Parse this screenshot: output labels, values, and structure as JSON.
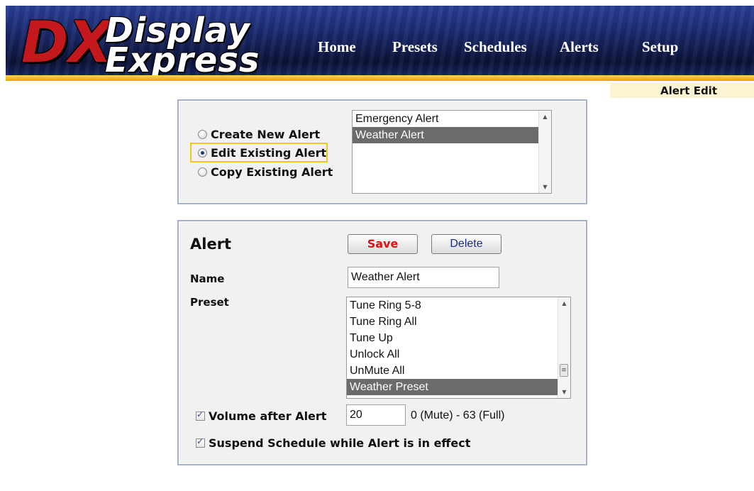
{
  "brand": {
    "logo_mark": "DX",
    "logo_line1": "Display",
    "logo_line2": "Express"
  },
  "nav": {
    "items": [
      "Home",
      "Presets",
      "Schedules",
      "Alerts",
      "Setup"
    ]
  },
  "page_tab": "Alert Edit",
  "mode": {
    "options": [
      "Create New Alert",
      "Edit Existing Alert",
      "Copy Existing Alert"
    ],
    "selected": "Edit Existing Alert"
  },
  "alerts_list": {
    "items": [
      "Emergency Alert",
      "Weather Alert"
    ],
    "selected": "Weather Alert"
  },
  "alert_form": {
    "title": "Alert",
    "save_label": "Save",
    "delete_label": "Delete",
    "name_label": "Name",
    "name_value": "Weather Alert",
    "preset_label": "Preset",
    "preset_items": [
      "Tune Ring 5-8",
      "Tune Ring All",
      "Tune Up",
      "Unlock All",
      "UnMute All",
      "Weather Preset"
    ],
    "preset_selected": "Weather Preset",
    "volume_label": "Volume after Alert",
    "volume_checked": true,
    "volume_value": "20",
    "volume_hint": "0 (Mute) - 63 (Full)",
    "suspend_label": "Suspend Schedule while Alert is in effect",
    "suspend_checked": true
  },
  "colors": {
    "header_blue": "#1b2a6e",
    "header_stripe": "#ffd24a",
    "logo_red": "#c4191c",
    "save_red": "#e01010",
    "selection_gray": "#6b6b6b",
    "panel_border": "#a3b2c8"
  }
}
